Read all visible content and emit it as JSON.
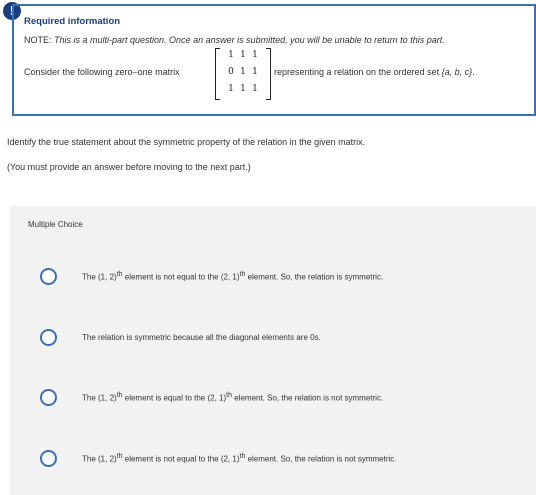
{
  "alert": {
    "glyph": "!"
  },
  "info": {
    "title": "Required information",
    "note_prefix": "NOTE: ",
    "note_italic": "This is a multi-part question. Once an answer is submitted, you will be unable to return to this part.",
    "consider_left": "Consider the following zero–one matrix",
    "consider_right_prefix": "representing a relation on the ordered set ",
    "set_label": "{a, b, c}",
    "consider_right_suffix": ".",
    "matrix": [
      [
        "1",
        "1",
        "1"
      ],
      [
        "0",
        "1",
        "1"
      ],
      [
        "1",
        "1",
        "1"
      ]
    ]
  },
  "question": {
    "prompt": "Identify the true statement about the symmetric property of the relation in the given matrix.",
    "note": "(You must provide an answer before moving to the next part.)"
  },
  "multiple_choice": {
    "label": "Multiple Choice",
    "options": [
      {
        "a": "The (1, 2)",
        "sup1": "th",
        "b": " element is not equal to the (2, 1)",
        "sup2": "th",
        "c": " element. So, the relation is symmetric."
      },
      {
        "text": "The relation is symmetric because all the diagonal elements are 0s."
      },
      {
        "a": "The (1, 2)",
        "sup1": "th",
        "b": " element is equal to the (2, 1)",
        "sup2": "th",
        "c": " element. So, the relation is not symmetric."
      },
      {
        "a": "The (1, 2)",
        "sup1": "th",
        "b": " element is not equal to the (2, 1)",
        "sup2": "th",
        "c": " element. So, the relation is not symmetric."
      }
    ]
  }
}
